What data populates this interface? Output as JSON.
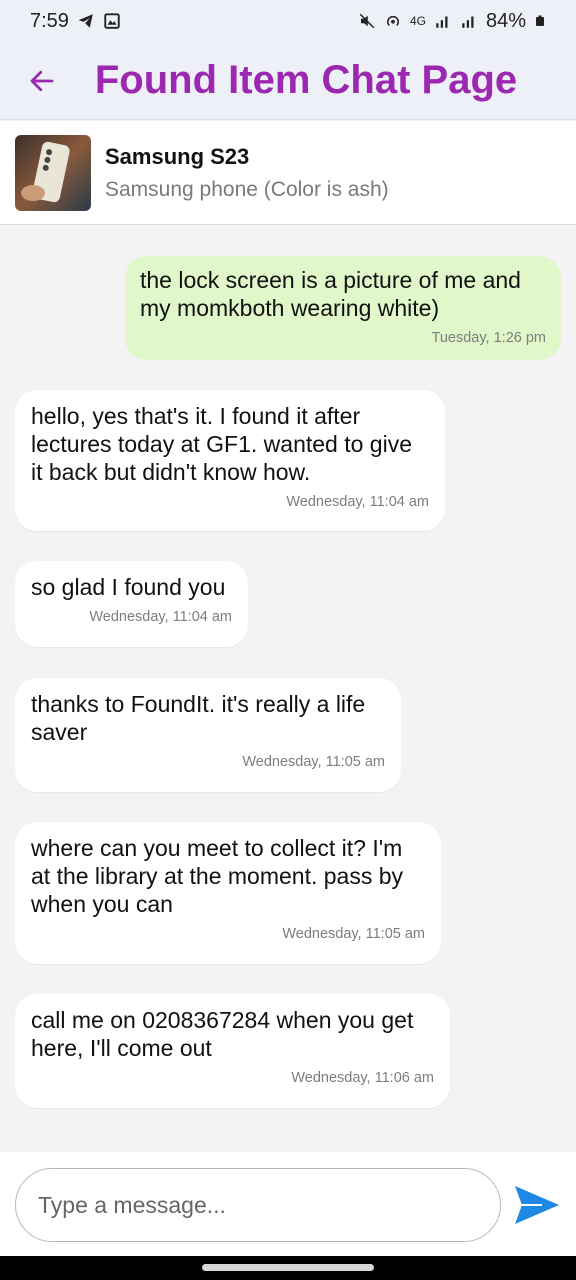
{
  "status_bar": {
    "time": "7:59",
    "network": "4G",
    "battery": "84%"
  },
  "app_bar": {
    "title": "Found Item Chat Page",
    "back_icon": "arrow-left-icon",
    "accent_color": "#9c27b0"
  },
  "item": {
    "name": "Samsung S23",
    "description": "Samsung phone (Color is ash)"
  },
  "messages": [
    {
      "direction": "out",
      "text": "the lock screen is a picture of me and my momkboth wearing white)",
      "time": "Tuesday, 1:26 pm"
    },
    {
      "direction": "in",
      "text": "hello, yes that's it. I found it after lectures today at GF1. wanted to give it back but didn't know how.",
      "time": "Wednesday, 11:04 am"
    },
    {
      "direction": "in",
      "text": "so glad I found you",
      "time": "Wednesday, 11:04 am"
    },
    {
      "direction": "in",
      "text": "thanks to FoundIt. it's really a life saver",
      "time": "Wednesday, 11:05 am"
    },
    {
      "direction": "in",
      "text": "where can you meet to collect it? I'm at the library at the moment. pass by when you can",
      "time": "Wednesday, 11:05 am"
    },
    {
      "direction": "in",
      "text": "call me on 0208367284 when you get here, I'll come out",
      "time": "Wednesday, 11:06 am"
    }
  ],
  "composer": {
    "placeholder": "Type a message...",
    "send_icon": "send-icon",
    "send_color": "#1e88e5"
  }
}
